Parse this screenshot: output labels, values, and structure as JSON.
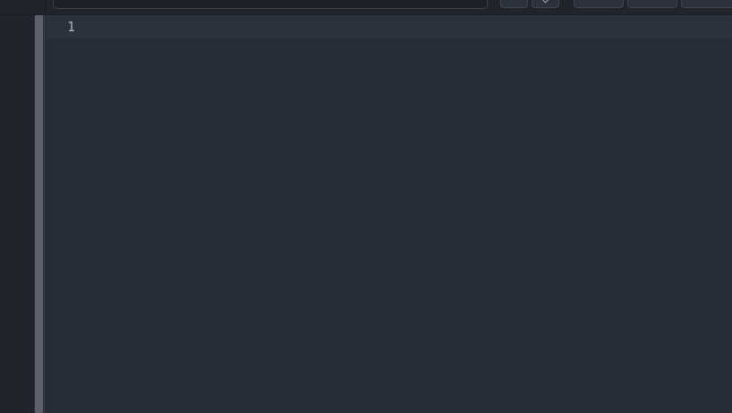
{
  "toolbar": {
    "search": {
      "value": "",
      "placeholder": ""
    },
    "prev_icon": "chevron-up-icon",
    "next_icon": "chevron-down-icon",
    "option_buttons": [
      "",
      "",
      ""
    ]
  },
  "editor": {
    "lines": [
      {
        "number": "1",
        "text": ""
      }
    ]
  },
  "colors": {
    "background": "#282c34",
    "current_line": "#2c313c",
    "text": "#abb2bf",
    "scrollbar_thumb": "#5b606b"
  }
}
